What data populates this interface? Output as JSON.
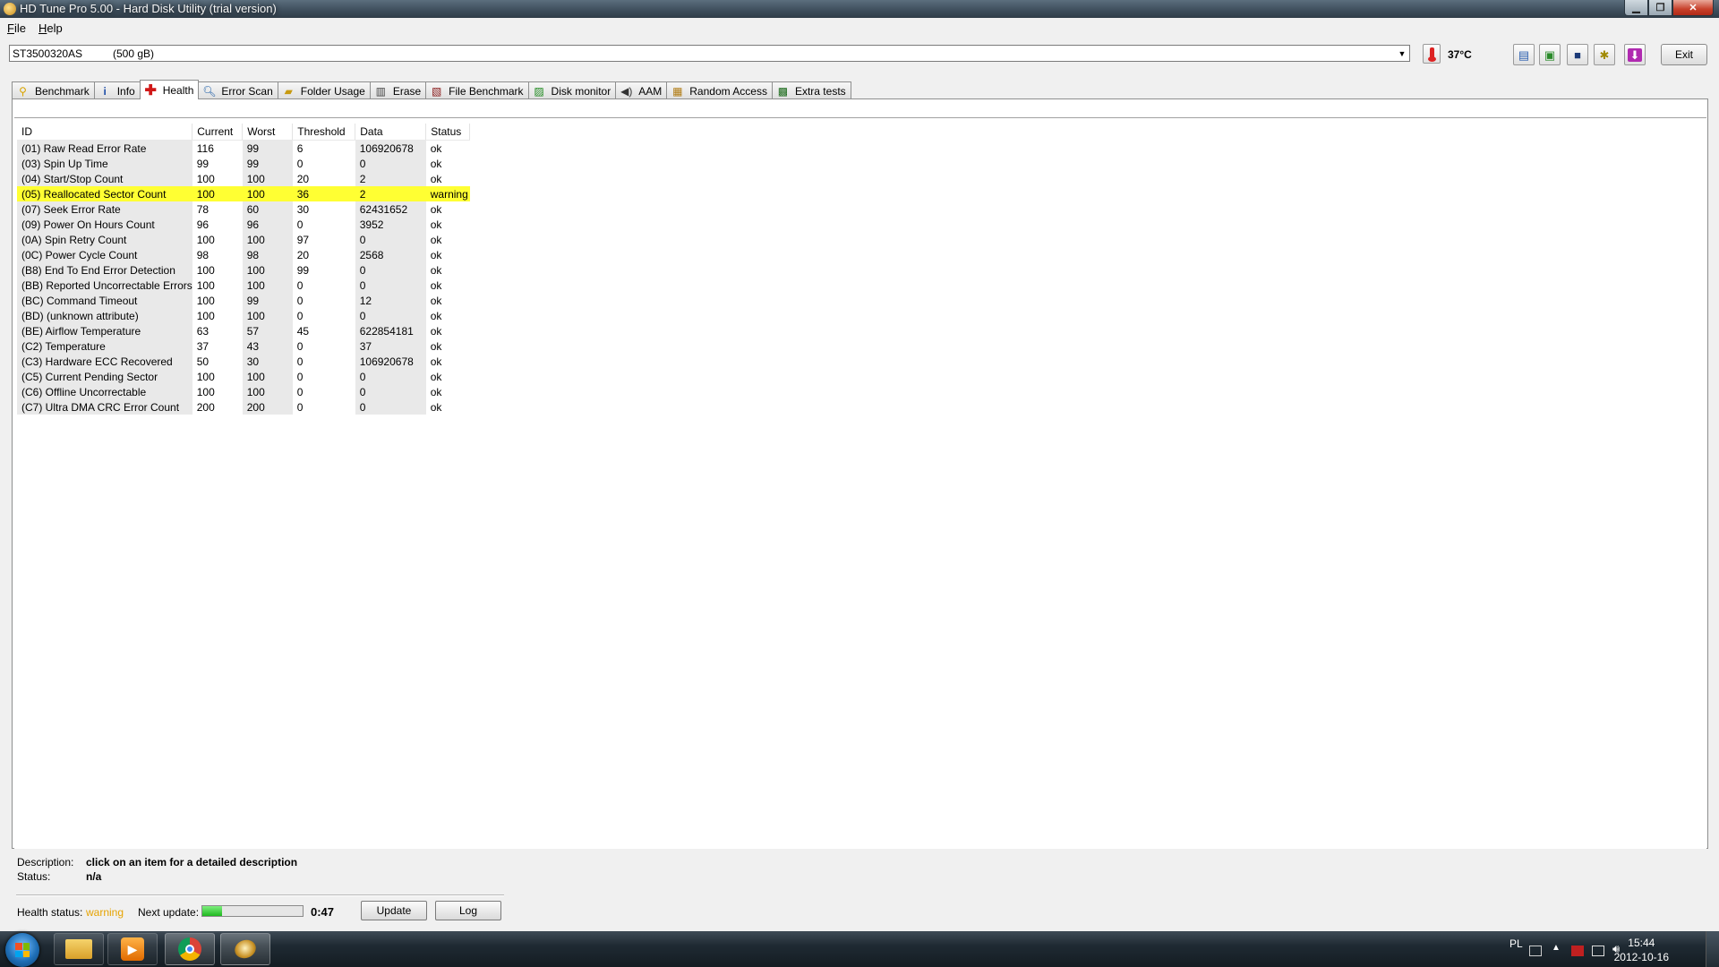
{
  "window": {
    "title": "HD Tune Pro 5.00 - Hard Disk Utility (trial version)",
    "controls": [
      "minimize",
      "maximize",
      "close"
    ]
  },
  "menu": [
    {
      "label": "File",
      "accel": "F",
      "rest": "ile"
    },
    {
      "label": "Help",
      "accel": "H",
      "rest": "elp"
    }
  ],
  "drive": {
    "model": "ST3500320AS",
    "size": "(500 gB)"
  },
  "temperature": "37°C",
  "toolbar": {
    "icons": [
      "copy-text-icon",
      "copy-screenshot-icon",
      "save-icon",
      "options-icon",
      "download-icon"
    ],
    "exit_label": "Exit"
  },
  "tabs": [
    {
      "label": "Benchmark",
      "icon": "benchmark-icon",
      "active": false
    },
    {
      "label": "Info",
      "icon": "info-icon",
      "active": false
    },
    {
      "label": "Health",
      "icon": "health-cross-icon",
      "active": true
    },
    {
      "label": "Error Scan",
      "icon": "magnifier-icon",
      "active": false
    },
    {
      "label": "Folder Usage",
      "icon": "folder-icon",
      "active": false
    },
    {
      "label": "Erase",
      "icon": "trash-icon",
      "active": false
    },
    {
      "label": "File Benchmark",
      "icon": "file-benchmark-icon",
      "active": false
    },
    {
      "label": "Disk monitor",
      "icon": "disk-monitor-icon",
      "active": false
    },
    {
      "label": "AAM",
      "icon": "speaker-icon",
      "active": false
    },
    {
      "label": "Random Access",
      "icon": "random-access-icon",
      "active": false
    },
    {
      "label": "Extra tests",
      "icon": "extra-tests-icon",
      "active": false
    }
  ],
  "health": {
    "columns": [
      "ID",
      "Current",
      "Worst",
      "Threshold",
      "Data",
      "Status"
    ],
    "rows": [
      {
        "id": "(01) Raw Read Error Rate",
        "current": "116",
        "worst": "99",
        "threshold": "6",
        "data": "106920678",
        "status": "ok"
      },
      {
        "id": "(03) Spin Up Time",
        "current": "99",
        "worst": "99",
        "threshold": "0",
        "data": "0",
        "status": "ok"
      },
      {
        "id": "(04) Start/Stop Count",
        "current": "100",
        "worst": "100",
        "threshold": "20",
        "data": "2",
        "status": "ok"
      },
      {
        "id": "(05) Reallocated Sector Count",
        "current": "100",
        "worst": "100",
        "threshold": "36",
        "data": "2",
        "status": "warning"
      },
      {
        "id": "(07) Seek Error Rate",
        "current": "78",
        "worst": "60",
        "threshold": "30",
        "data": "62431652",
        "status": "ok"
      },
      {
        "id": "(09) Power On Hours Count",
        "current": "96",
        "worst": "96",
        "threshold": "0",
        "data": "3952",
        "status": "ok"
      },
      {
        "id": "(0A) Spin Retry Count",
        "current": "100",
        "worst": "100",
        "threshold": "97",
        "data": "0",
        "status": "ok"
      },
      {
        "id": "(0C) Power Cycle Count",
        "current": "98",
        "worst": "98",
        "threshold": "20",
        "data": "2568",
        "status": "ok"
      },
      {
        "id": "(B8) End To End Error Detection",
        "current": "100",
        "worst": "100",
        "threshold": "99",
        "data": "0",
        "status": "ok"
      },
      {
        "id": "(BB) Reported Uncorrectable Errors",
        "current": "100",
        "worst": "100",
        "threshold": "0",
        "data": "0",
        "status": "ok"
      },
      {
        "id": "(BC) Command Timeout",
        "current": "100",
        "worst": "99",
        "threshold": "0",
        "data": "12",
        "status": "ok"
      },
      {
        "id": "(BD) (unknown attribute)",
        "current": "100",
        "worst": "100",
        "threshold": "0",
        "data": "0",
        "status": "ok"
      },
      {
        "id": "(BE) Airflow Temperature",
        "current": "63",
        "worst": "57",
        "threshold": "45",
        "data": "622854181",
        "status": "ok"
      },
      {
        "id": "(C2) Temperature",
        "current": "37",
        "worst": "43",
        "threshold": "0",
        "data": "37",
        "status": "ok"
      },
      {
        "id": "(C3) Hardware ECC Recovered",
        "current": "50",
        "worst": "30",
        "threshold": "0",
        "data": "106920678",
        "status": "ok"
      },
      {
        "id": "(C5) Current Pending Sector",
        "current": "100",
        "worst": "100",
        "threshold": "0",
        "data": "0",
        "status": "ok"
      },
      {
        "id": "(C6) Offline Uncorrectable",
        "current": "100",
        "worst": "100",
        "threshold": "0",
        "data": "0",
        "status": "ok"
      },
      {
        "id": "(C7) Ultra DMA CRC Error Count",
        "current": "200",
        "worst": "200",
        "threshold": "0",
        "data": "0",
        "status": "ok"
      }
    ]
  },
  "details": {
    "description_label": "Description:",
    "description_value": "click on an item for a detailed description",
    "status_label": "Status:",
    "status_value": "n/a"
  },
  "footer": {
    "health_status_label": "Health status:",
    "health_status_value": "warning",
    "health_status_color": "#e6a300",
    "next_update_label": "Next update:",
    "next_update_progress": 0.2,
    "countdown": "0:47",
    "update_label": "Update",
    "log_label": "Log"
  },
  "taskbar": {
    "apps": [
      "windows-explorer-icon",
      "media-player-icon",
      "chrome-icon",
      "hdtune-icon"
    ],
    "language": "PL",
    "time": "15:44",
    "date": "2012-10-16"
  },
  "colors": {
    "warning_row": "#ffff33",
    "alt_column": "#e9e9e9"
  }
}
